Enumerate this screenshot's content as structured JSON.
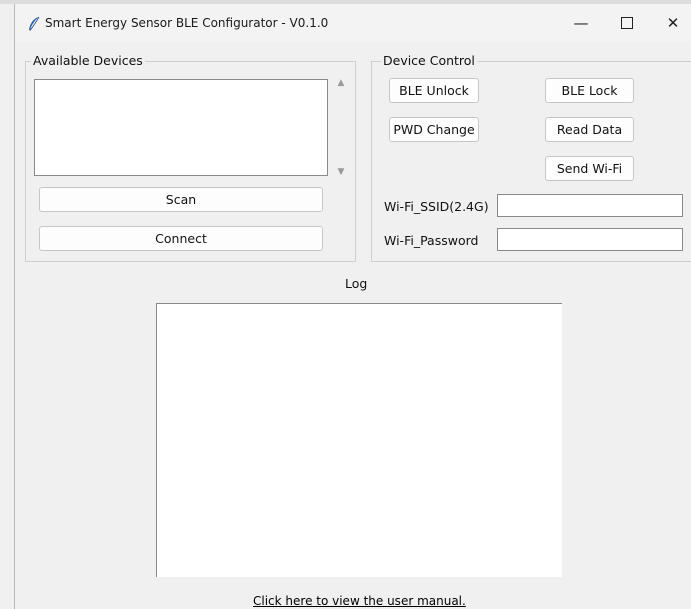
{
  "window": {
    "title": "Smart Energy Sensor BLE Configurator - V0.1.0",
    "controls": {
      "minimize": "—",
      "close": "✕"
    }
  },
  "devices": {
    "group_label": "Available Devices",
    "scan_label": "Scan",
    "connect_label": "Connect"
  },
  "control": {
    "group_label": "Device Control",
    "ble_unlock": "BLE Unlock",
    "ble_lock": "BLE Lock",
    "pwd_change": "PWD Change",
    "read_data": "Read Data",
    "send_wifi": "Send Wi-Fi",
    "ssid_label": "Wi-Fi_SSID(2.4G)",
    "password_label": "Wi-Fi_Password",
    "ssid_value": "",
    "password_value": ""
  },
  "log": {
    "label": "Log"
  },
  "footer": {
    "manual_link": "Click here to view the user manual."
  },
  "colors": {
    "window_bg": "#f0f0f0",
    "titlebar_bg": "#f3f3f3",
    "field_bg": "#ffffff",
    "icon_blue": "#2d5fb0"
  },
  "icons": {
    "app": "feather-icon",
    "minimize": "minimize-icon",
    "maximize": "maximize-icon",
    "close": "close-icon"
  }
}
